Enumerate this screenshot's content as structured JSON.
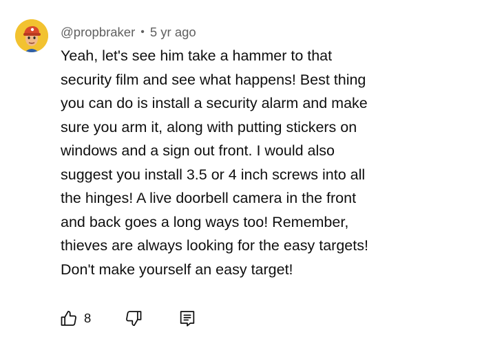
{
  "comment": {
    "author": "@propbraker",
    "separator": "•",
    "time": "5 yr ago",
    "lines": [
      "Yeah, let's see him take a hammer to that",
      "security film and see what happens!  Best thing",
      "you can do is install a security alarm and make",
      "sure you arm it, along with putting stickers on",
      "windows and a sign out front.  I would also",
      "suggest you install 3.5 or 4 inch screws into all",
      "the hinges!  A live doorbell camera in the front",
      "and back goes a long ways too!   Remember,",
      "thieves are always looking for the easy targets!",
      "Don't make yourself an easy target!"
    ],
    "avatar_icon": "cartoon-face-with-cap-avatar",
    "actions": {
      "like_icon": "thumbs-up-icon",
      "like_count": "8",
      "dislike_icon": "thumbs-down-icon",
      "reply_icon": "reply-comment-icon"
    }
  },
  "colors": {
    "text": "#0f0f0f",
    "meta": "#606060",
    "avatar_bg": "#f2c230"
  }
}
